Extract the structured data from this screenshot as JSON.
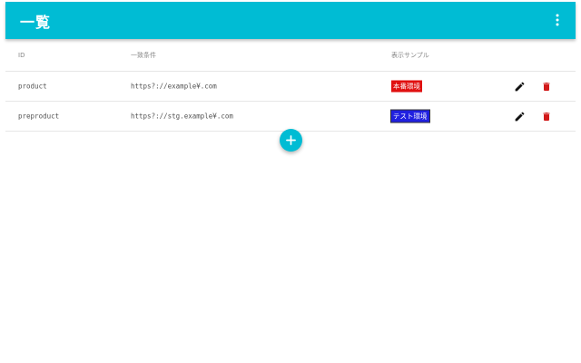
{
  "appbar": {
    "title": "一覧",
    "menu_icon": "more-vert-icon",
    "color": "#00bcd4"
  },
  "table": {
    "headers": {
      "id": "ID",
      "condition": "一致条件",
      "sample": "表示サンプル"
    },
    "rows": [
      {
        "id": "product",
        "condition": "https?://example¥.com",
        "sample_label": "本番環境",
        "sample_color": "#e01010",
        "edit_icon": "pencil-icon",
        "delete_icon": "trash-icon"
      },
      {
        "id": "preproduct",
        "condition": "https?://stg.example¥.com",
        "sample_label": "テスト環境",
        "sample_color": "#2020e0",
        "edit_icon": "pencil-icon",
        "delete_icon": "trash-icon"
      }
    ]
  },
  "fab": {
    "icon": "plus-icon",
    "color": "#00bcd4"
  },
  "colors": {
    "delete": "#d11a1a"
  }
}
